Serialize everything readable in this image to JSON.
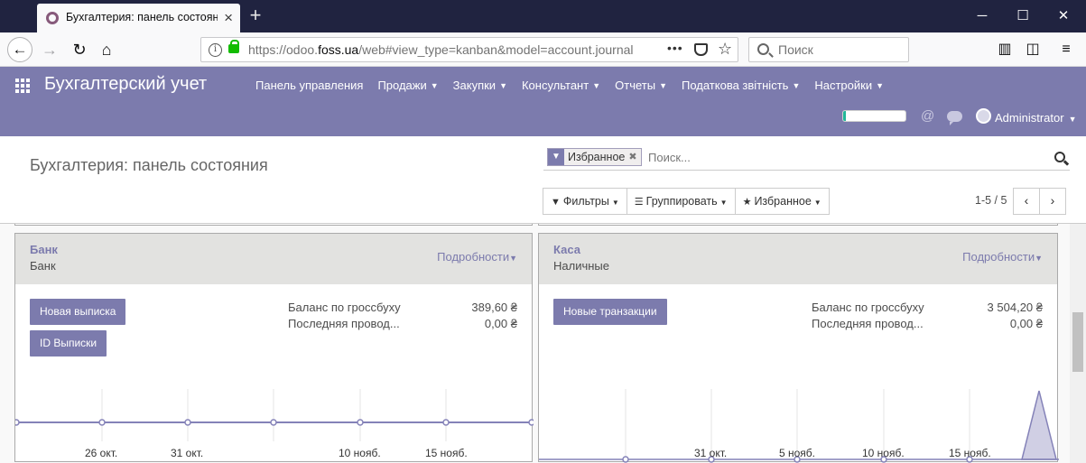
{
  "browser": {
    "tab_title": "Бухгалтерия: панель состояния",
    "url_prefix": "https://odoo.",
    "url_domain": "foss.ua",
    "url_rest": "/web#view_type=kanban&model=account.journal",
    "search_placeholder": "Поиск",
    "page_actions": "•••"
  },
  "app": {
    "brand": "Бухгалтерский учет",
    "menu": [
      {
        "label": "Панель управления",
        "dropdown": false
      },
      {
        "label": "Продажи",
        "dropdown": true
      },
      {
        "label": "Закупки",
        "dropdown": true
      },
      {
        "label": "Консультант",
        "dropdown": true
      },
      {
        "label": "Отчеты",
        "dropdown": true
      },
      {
        "label": "Податкова звітність",
        "dropdown": true
      },
      {
        "label": "Настройки",
        "dropdown": true
      }
    ],
    "progress": 0.04,
    "user": "Administrator",
    "accent_color": "#7c7bad"
  },
  "control": {
    "breadcrumb": "Бухгалтерия: панель состояния",
    "facet_label": "Избранное",
    "search_placeholder": "Поиск...",
    "filters_label": "Фильтры",
    "group_label": "Группировать",
    "favorites_label": "Избранное",
    "pager": "1-5 / 5",
    "prev": "‹",
    "next": "›"
  },
  "cards": [
    {
      "title": "Банк",
      "subtitle": "Банк",
      "more": "Подробности",
      "buttons": [
        "Новая выписка",
        "ID Выписки"
      ],
      "stats": [
        {
          "label": "Баланс по гроссбуху",
          "value": "389,60 ₴"
        },
        {
          "label": "Последняя провод...",
          "value": "0,00 ₴"
        }
      ],
      "chart_type": "line",
      "x_labels": [
        "26 окт.",
        "31 окт.",
        "10 нояб.",
        "15 нояб."
      ]
    },
    {
      "title": "Каса",
      "subtitle": "Наличные",
      "more": "Подробности",
      "buttons": [
        "Новые транзакции"
      ],
      "stats": [
        {
          "label": "Баланс по гроссбуху",
          "value": "3 504,20 ₴"
        },
        {
          "label": "Последняя провод...",
          "value": "0,00 ₴"
        }
      ],
      "chart_type": "area",
      "x_labels": [
        "31 окт.",
        "5 нояб.",
        "10 нояб.",
        "15 нояб."
      ]
    }
  ]
}
